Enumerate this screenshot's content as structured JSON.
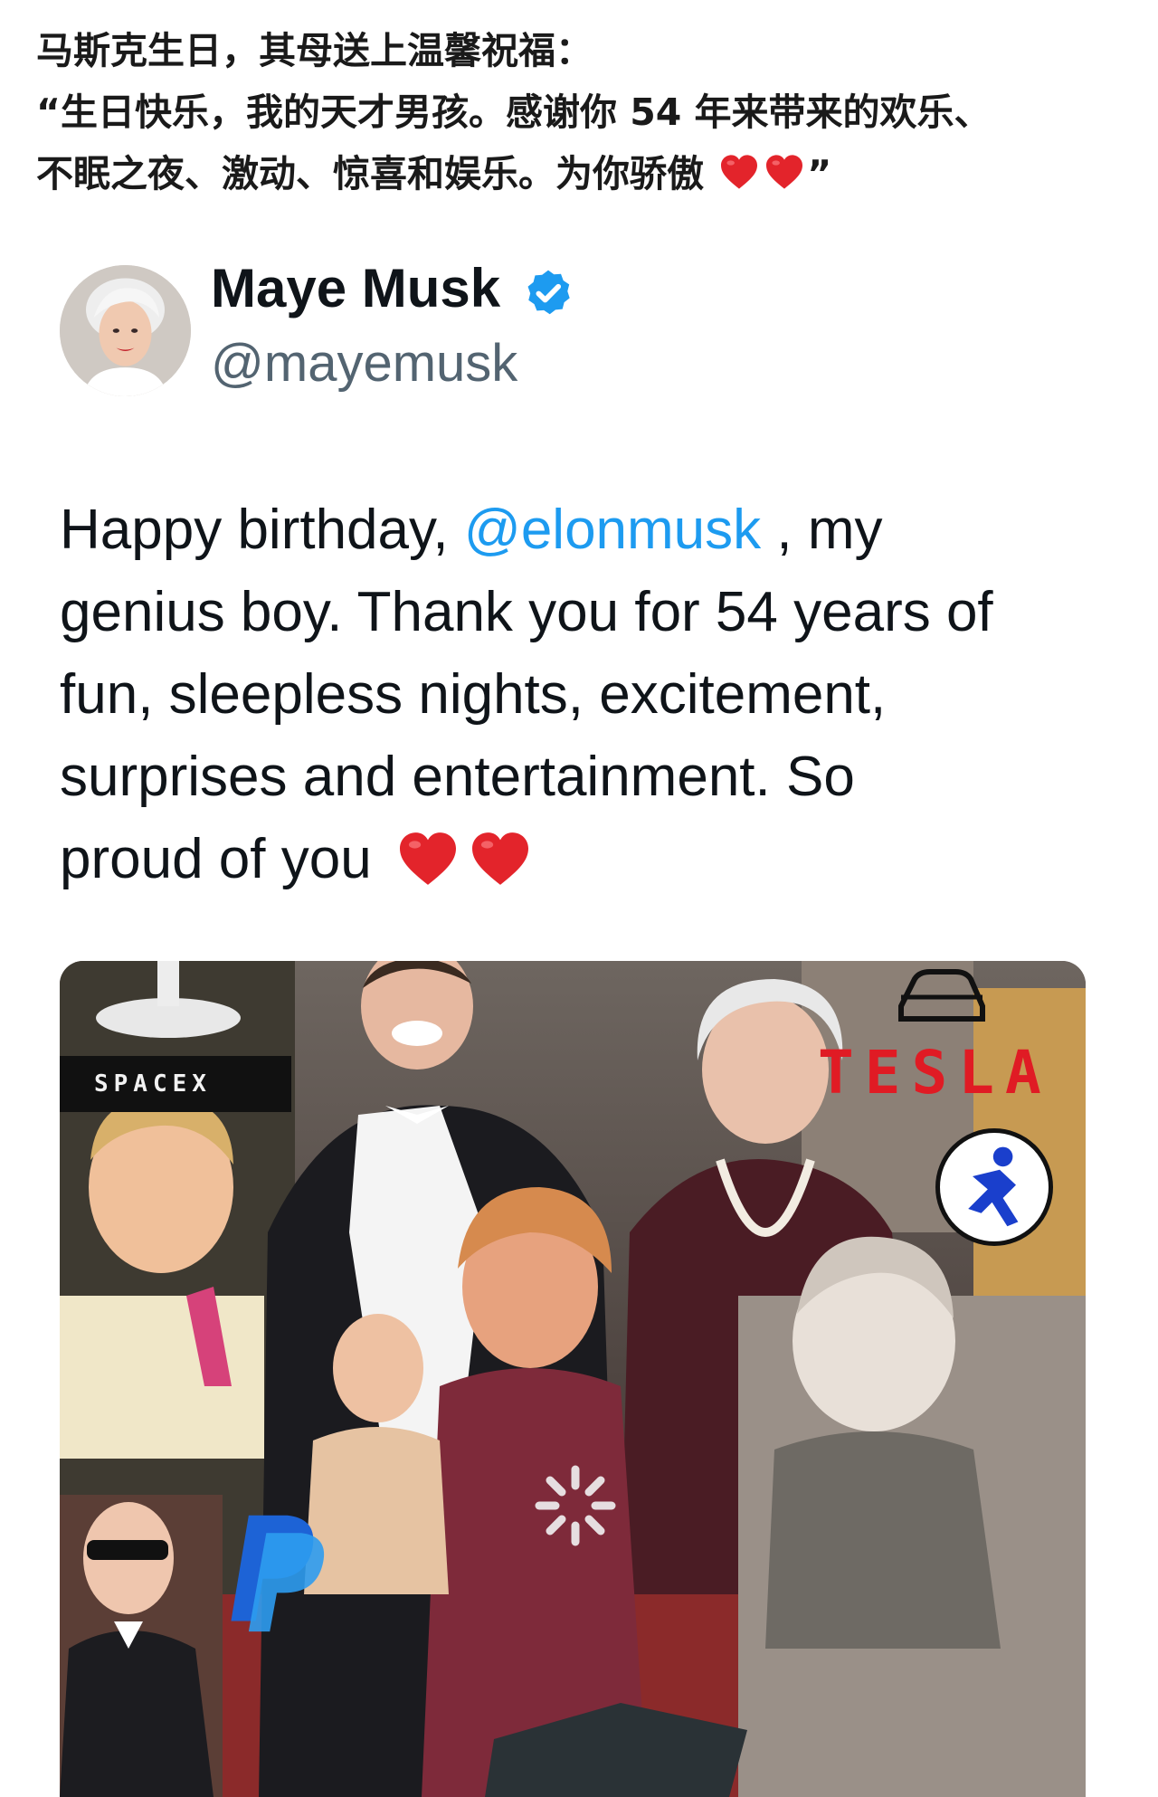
{
  "caption": {
    "line1": "马斯克生日，其母送上温馨祝福：",
    "line2": "“生日快乐，我的天才男孩。感谢你 54 年来带来的欢乐、",
    "line3_text": "不眠之夜、激动、惊喜和娱乐。为你骄傲",
    "line3_close": "”",
    "heart_icon": "red-heart-emoji",
    "heart_color": "#e3242b"
  },
  "tweet": {
    "display_name": "Maye Musk",
    "handle": "@mayemusk",
    "verified_icon": "verified-badge-icon",
    "verified_color": "#1d9bf0",
    "text": {
      "line1_before": "Happy birthday, ",
      "mention": "@elonmusk",
      "line1_after": " , my",
      "line2": "genius boy. Thank you for 54 years of",
      "line3": "fun, sleepless nights, excitement,",
      "line4": "surprises and entertainment. So",
      "line5": "proud of you"
    },
    "mention_color": "#1d9bf0"
  },
  "media": {
    "spacex_label": "SPACEX",
    "tesla_label": "TESLA",
    "icons": [
      "rocket-launch-icon",
      "tesla-car-icon",
      "running-man-badge-icon",
      "paypal-logo-icon",
      "loading-spinner-icon"
    ]
  }
}
